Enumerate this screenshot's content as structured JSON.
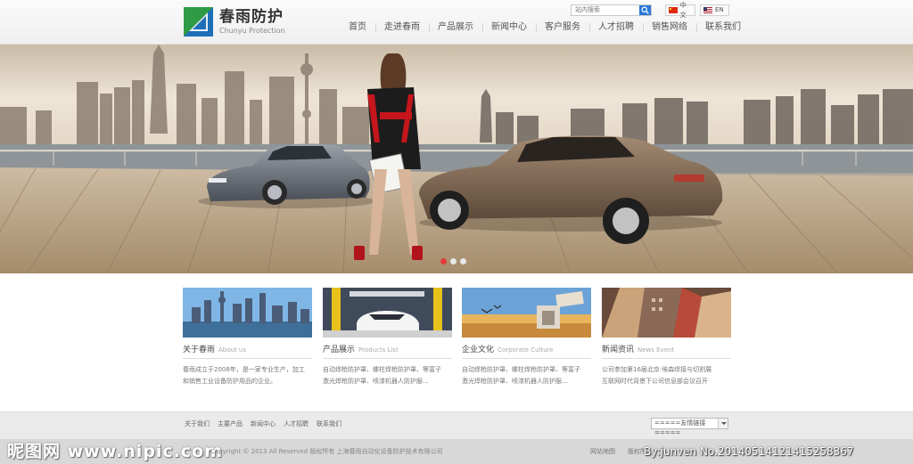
{
  "header": {
    "logo_cn": "春雨防护",
    "logo_en": "Chunyu Protection",
    "search_placeholder": "站内搜索",
    "lang_cn": "中文",
    "lang_en": "EN",
    "nav": [
      "首页",
      "走进春雨",
      "产品展示",
      "新闻中心",
      "客户服务",
      "人才招聘",
      "销售网络",
      "联系我们"
    ]
  },
  "banner": {
    "slide_count": 3,
    "active_slide": 1
  },
  "sections": [
    {
      "title": "关于春雨",
      "title_en": "About us",
      "line1": "春雨成立于2008年，是一家专业生产，加工",
      "line2": "和销售工业设备防护用品的企业。"
    },
    {
      "title": "产品展示",
      "title_en": "Products List",
      "line1": "自动焊枪防护罩、螺柱焊枪防护罩、等富子",
      "line2": "激光焊枪防护罩、喷漆机器人防护服..."
    },
    {
      "title": "企业文化",
      "title_en": "Corporate Culture",
      "line1": "自动焊枪防护罩、螺柱焊枪防护罩、等富子",
      "line2": "激光焊枪防护罩、喷漆机器人防护服..."
    },
    {
      "title": "新闻资讯",
      "title_en": "News Event",
      "line1": "公司参加第16届北京·埃森焊接与切割展",
      "line2": "互联网时代背景下公司信息部会议召开"
    }
  ],
  "footer": {
    "links": [
      "关于我们",
      "主要产品",
      "新闻中心",
      "人才招聘",
      "联系我们"
    ],
    "friend_links": "=====友情链接=====",
    "copyright": "Copyright © 2013 All Reserved 版权所有  上海春雨自动化设备防护技术有限公司",
    "sitemap": "网站地图",
    "copy2": "版权所",
    "watermark_left": "昵图网 www.nipic.com",
    "watermark_right": "By:junven No.20140514121415258367"
  },
  "colors": {
    "accent_blue": "#2a7ad8",
    "logo_green": "#3aa24a",
    "dot_active": "#e23a3a"
  }
}
